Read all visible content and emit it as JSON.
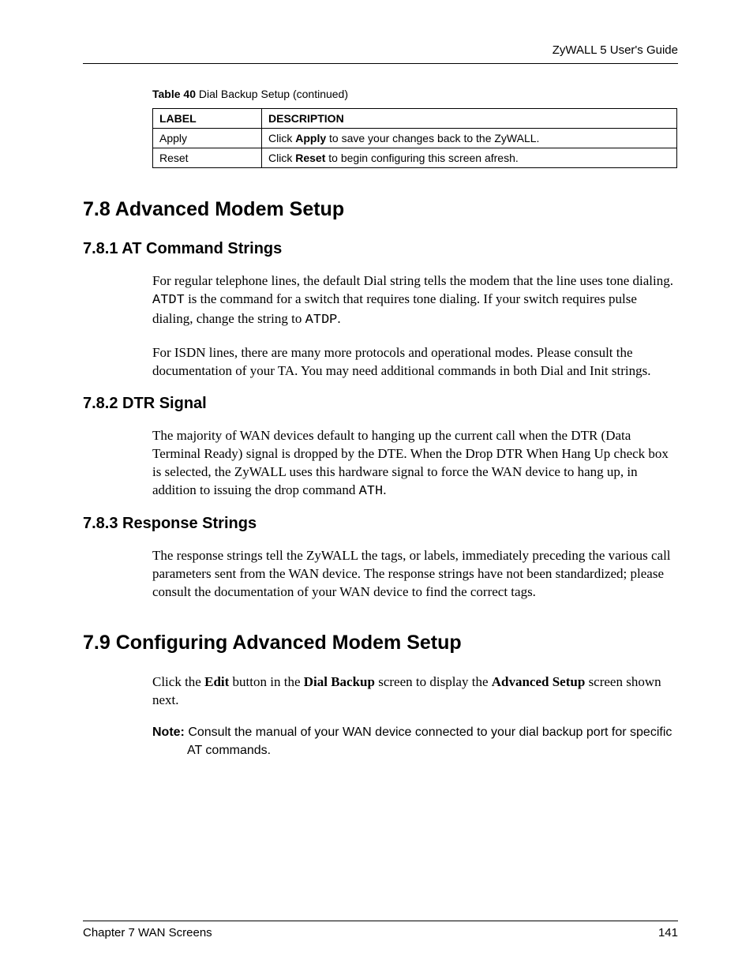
{
  "header": {
    "guide_title": "ZyWALL 5 User's Guide"
  },
  "table": {
    "caption_bold": "Table 40",
    "caption_rest": "   Dial Backup Setup (continued)",
    "columns": {
      "label": "LABEL",
      "description": "DESCRIPTION"
    },
    "rows": {
      "apply": {
        "label": "Apply",
        "desc_pre": "Click ",
        "desc_bold": "Apply",
        "desc_post": " to save your changes back to the ZyWALL."
      },
      "reset": {
        "label": "Reset",
        "desc_pre": "Click ",
        "desc_bold": "Reset",
        "desc_post": " to begin configuring this screen afresh."
      }
    }
  },
  "sections": {
    "s78": {
      "heading": "7.8  Advanced Modem Setup",
      "s781": {
        "heading": "7.8.1  AT Command Strings",
        "p1_a": "For regular telephone lines, the default Dial string tells the modem that the line uses tone dialing. ",
        "p1_mono1": "ATDT",
        "p1_b": " is the command for a switch that requires tone dialing. If your switch requires pulse dialing, change the string to ",
        "p1_mono2": "ATDP",
        "p1_c": ".",
        "p2": "For ISDN lines, there are many more protocols and operational modes. Please consult the documentation of your TA. You may need additional commands in both Dial and Init strings."
      },
      "s782": {
        "heading": "7.8.2  DTR Signal",
        "p1_a": "The majority of WAN devices default to hanging up the current call when the DTR (Data Terminal Ready) signal is dropped by the DTE. When the Drop DTR When Hang Up check box is selected, the ZyWALL uses this hardware signal to force the WAN device to hang up, in addition to issuing the drop command ",
        "p1_mono": "ATH",
        "p1_b": "."
      },
      "s783": {
        "heading": "7.8.3  Response Strings",
        "p1": "The response strings tell the ZyWALL the tags, or labels, immediately preceding the various call parameters sent from the WAN device. The response strings have not been standardized; please consult the documentation of your WAN device to find the correct tags."
      }
    },
    "s79": {
      "heading": "7.9  Configuring Advanced Modem Setup",
      "p1_a": "Click the ",
      "p1_b1": "Edit",
      "p1_b": " button in the ",
      "p1_b2": "Dial Backup",
      "p1_c": " screen to display the ",
      "p1_b3": "Advanced Setup",
      "p1_d": " screen shown next.",
      "note_label": "Note: ",
      "note_text": "Consult the manual of your WAN device connected to your dial backup port for specific AT commands."
    }
  },
  "footer": {
    "chapter": "Chapter 7 WAN Screens",
    "page": "141"
  }
}
